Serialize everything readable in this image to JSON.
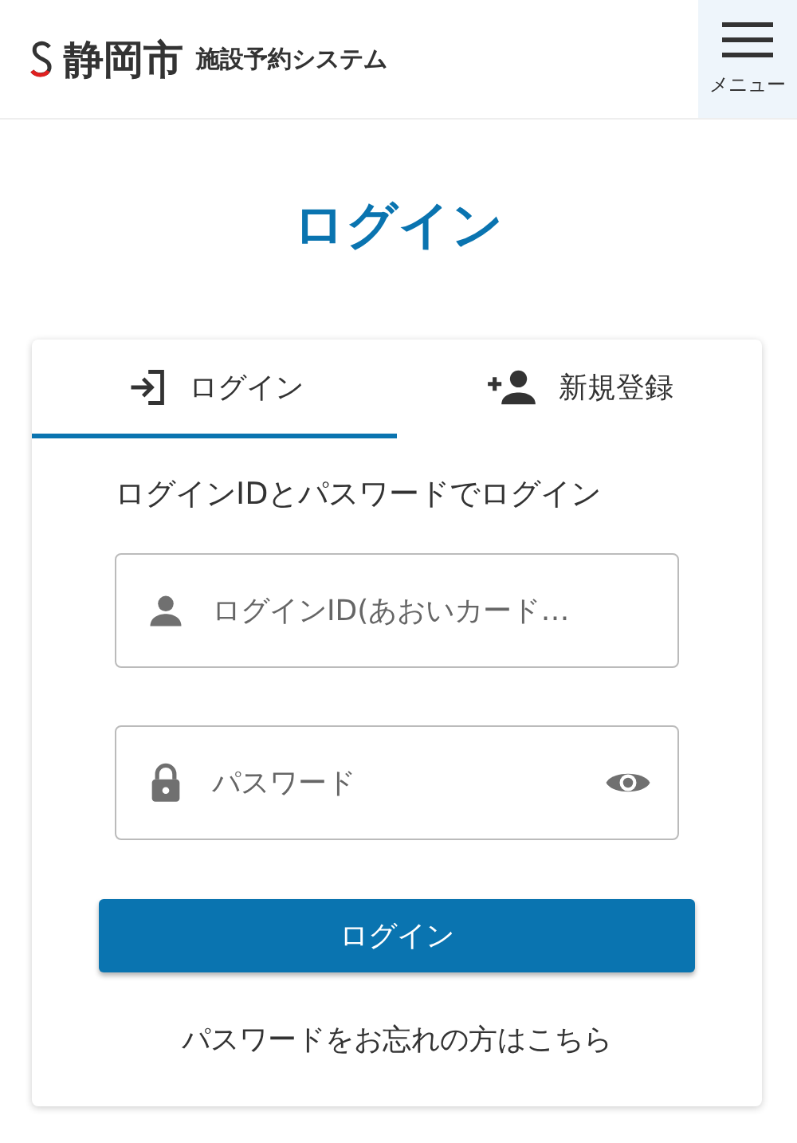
{
  "header": {
    "city": "静岡市",
    "system": "施設予約システム",
    "menu_label": "メニュー"
  },
  "page_title": "ログイン",
  "tabs": [
    {
      "label": "ログイン",
      "kind": "login",
      "selected": true
    },
    {
      "label": "新規登録",
      "kind": "register",
      "selected": false
    }
  ],
  "instruction": "ログインIDとパスワードでログイン",
  "fields": [
    {
      "kind": "user",
      "placeholder": "ログインID(あおいカード…"
    },
    {
      "kind": "password",
      "placeholder": "パスワード"
    }
  ],
  "submit": "ログイン",
  "forgot_link": "パスワードをお忘れの方はこちら"
}
